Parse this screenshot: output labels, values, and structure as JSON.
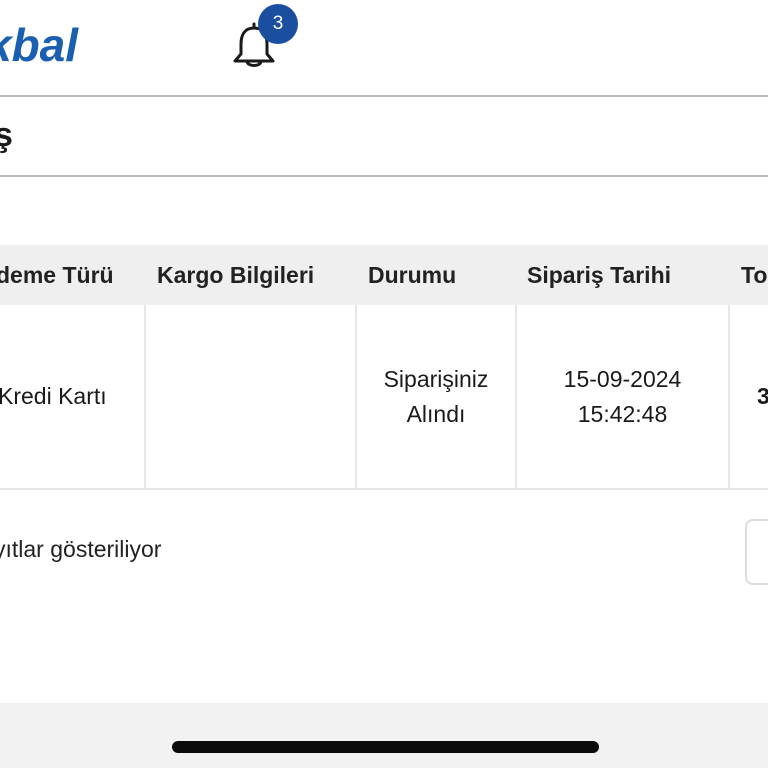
{
  "header": {
    "logo_text": "kbal",
    "notification_count": "3",
    "brand_color": "#1a5fb0",
    "badge_color": "#1a4fa0"
  },
  "breadcrumb": {
    "title": "ş"
  },
  "table": {
    "columns": [
      "deme Türü",
      "Kargo Bilgileri",
      "Durumu",
      "Sipariş Tarihi",
      "To"
    ],
    "row": {
      "payment_type": "Kredi Kartı",
      "cargo_info": "",
      "status_line1": "Siparişiniz",
      "status_line2": "Alındı",
      "date": "15-09-2024",
      "time": "15:42:48",
      "total_partial": "3"
    }
  },
  "footer": {
    "records_info": "yıtlar gösteriliyor"
  }
}
